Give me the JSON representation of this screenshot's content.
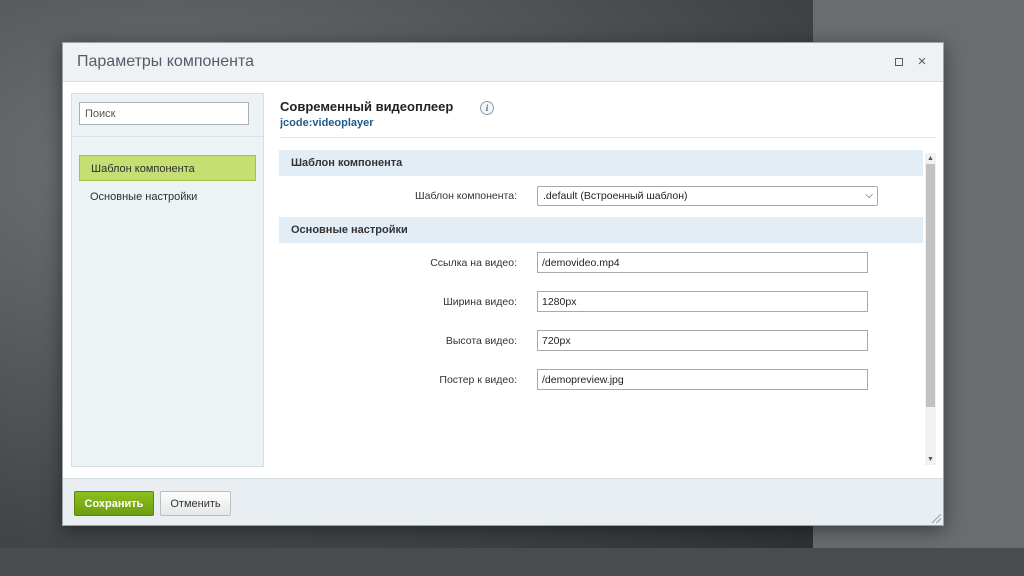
{
  "dialog": {
    "title": "Параметры компонента",
    "maximize_icon": "maximize-icon",
    "close_icon": "close-icon",
    "close_glyph": "×"
  },
  "sidebar": {
    "search_placeholder": "Поиск",
    "items": [
      {
        "label": "Шаблон компонента",
        "active": true
      },
      {
        "label": "Основные настройки",
        "active": false
      }
    ]
  },
  "component": {
    "title": "Современный видеоплеер",
    "code": "jcode:videoplayer",
    "info_icon": "info-icon",
    "info_glyph": "i"
  },
  "sections": {
    "template": {
      "header": "Шаблон компонента",
      "template_label": "Шаблон компонента:",
      "template_value": ".default (Встроенный шаблон)"
    },
    "main": {
      "header": "Основные настройки",
      "video_url_label": "Ссылка на видео:",
      "video_url_value": "/demovideo.mp4",
      "width_label": "Ширина видео:",
      "width_value": "1280px",
      "height_label": "Высота видео:",
      "height_value": "720px",
      "poster_label": "Постер к видео:",
      "poster_value": "/demopreview.jpg"
    }
  },
  "footer": {
    "save_label": "Сохранить",
    "cancel_label": "Отменить"
  },
  "colors": {
    "accent_green": "#7aaa14",
    "active_item": "#c7df72",
    "section_bg": "#e3edf6",
    "code_blue": "#1f5a89"
  }
}
